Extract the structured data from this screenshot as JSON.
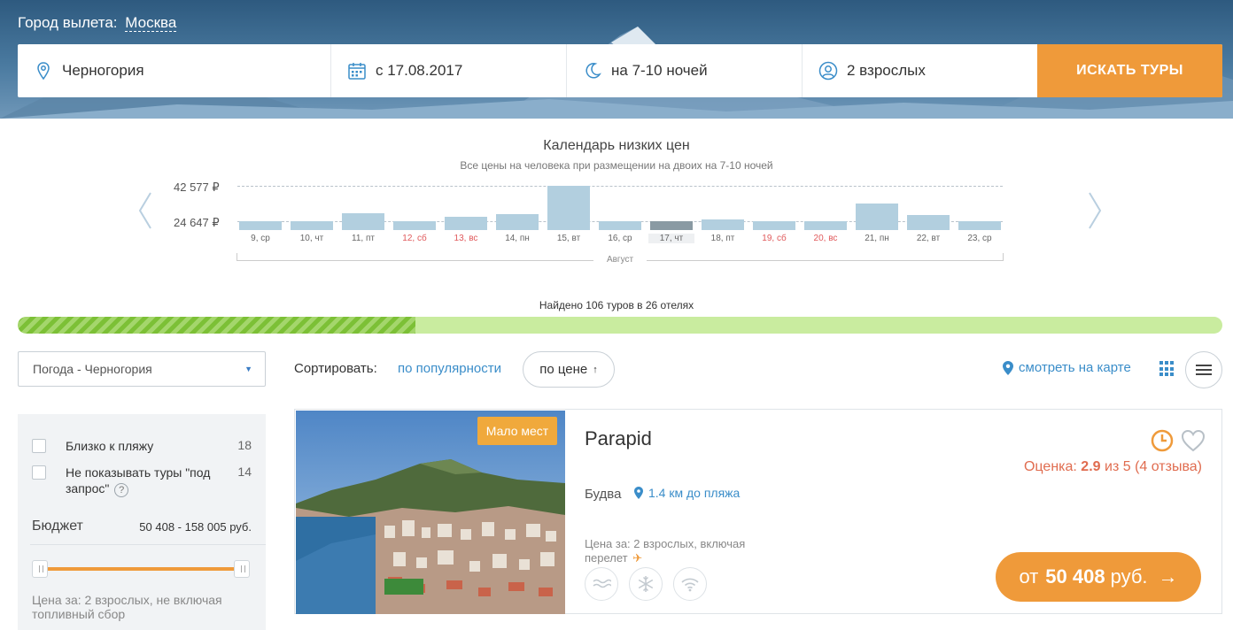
{
  "header": {
    "city_label": "Город вылета:",
    "city_value": "Москва"
  },
  "search": {
    "destination": "Черногория",
    "date": "с 17.08.2017",
    "nights": "на 7-10 ночей",
    "tourists": "2 взрослых",
    "button": "ИСКАТЬ ТУРЫ"
  },
  "calendar": {
    "title": "Календарь низких цен",
    "subtitle": "Все цены на человека при размещении на двоих на 7-10 ночей",
    "max_label": "42 577 ₽",
    "min_label": "24 647 ₽",
    "month": "Август"
  },
  "chart_data": {
    "type": "bar",
    "title": "Календарь низких цен",
    "categories": [
      "9, ср",
      "10, чт",
      "11, пт",
      "12, сб",
      "13, вс",
      "14, пн",
      "15, вт",
      "16, ср",
      "17, чт",
      "18, пт",
      "19, сб",
      "20, вс",
      "21, пн",
      "22, вт",
      "23, ср"
    ],
    "values": [
      24647,
      24647,
      28700,
      24647,
      27100,
      28300,
      42577,
      24647,
      24647,
      25600,
      24647,
      24647,
      33600,
      27800,
      24647
    ],
    "weekend": [
      false,
      false,
      false,
      true,
      true,
      false,
      false,
      false,
      false,
      false,
      true,
      true,
      false,
      false,
      false
    ],
    "selected_index": 8,
    "ylim": [
      20000,
      42577
    ],
    "colors": {
      "bar": "#b2cfdf",
      "selected": "#8a9aa3",
      "weekend_label": "#e0595b"
    }
  },
  "results": {
    "found_text": "Найдено 106 туров в 26 отелях",
    "progress": 0.33
  },
  "toolbar": {
    "weather_select": "Погода - Черногория",
    "sort_label": "Сортировать:",
    "sort_popularity": "по популярности",
    "sort_price": "по цене",
    "sort_price_arrow": "↑",
    "map_link": "смотреть на карте"
  },
  "filters": {
    "items": [
      {
        "label": "Близко к пляжу",
        "count": "18"
      },
      {
        "label": "Не показывать туры \"под запрос\"",
        "count": "14"
      }
    ],
    "help": "?",
    "budget_label": "Бюджет",
    "budget_range": "50 408 - 158 005 руб.",
    "budget_note": "Цена за: 2 взрослых, не включая топливный сбор"
  },
  "hotel": {
    "badge": "Мало мест",
    "name": "Parapid",
    "rating_prefix": "Оценка:",
    "rating_score": "2.9",
    "rating_suffix": "из 5 (4 отзыва)",
    "city": "Будва",
    "beach": "1.4 км до пляжа",
    "price_note": "Цена за: 2 взрослых, включая перелет",
    "price_prefix": "от",
    "price_amount": "50 408",
    "price_currency": "руб.",
    "price_arrow": "→",
    "amenities": [
      "pool-icon",
      "air-conditioning-icon",
      "wifi-icon"
    ]
  },
  "colors": {
    "accent": "#ef9a3a",
    "link": "#3a8dc9",
    "progress_done": "#7cc036",
    "progress_rest": "#c9ec9f",
    "rating": "#e06c4f"
  }
}
